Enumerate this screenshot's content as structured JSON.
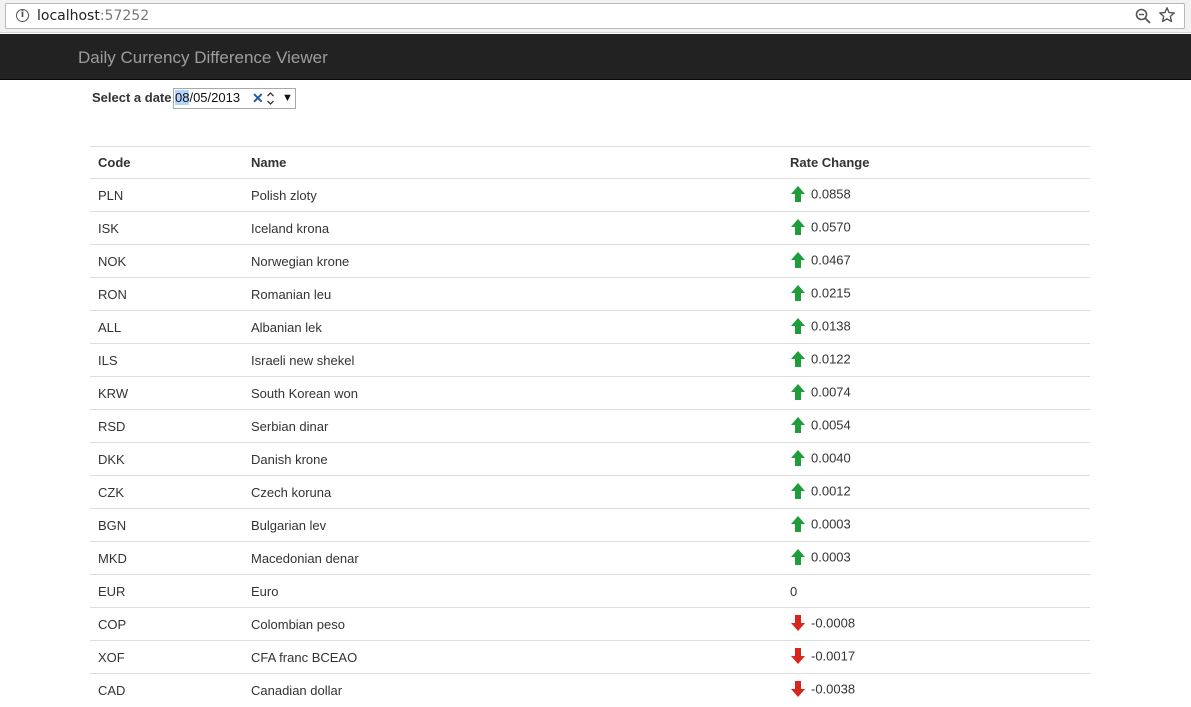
{
  "browser": {
    "url_host": "localhost",
    "url_port": ":57252"
  },
  "navbar": {
    "brand": "Daily Currency Difference Viewer"
  },
  "date_picker": {
    "label": "Select a date",
    "value_highlight": "08",
    "value_rest": "/05/2013"
  },
  "table": {
    "headers": {
      "code": "Code",
      "name": "Name",
      "rate_change": "Rate Change"
    },
    "rows": [
      {
        "code": "PLN",
        "name": "Polish zloty",
        "change": "0.0858",
        "trend": "up"
      },
      {
        "code": "ISK",
        "name": "Iceland krona",
        "change": "0.0570",
        "trend": "up"
      },
      {
        "code": "NOK",
        "name": "Norwegian krone",
        "change": "0.0467",
        "trend": "up"
      },
      {
        "code": "RON",
        "name": "Romanian leu",
        "change": "0.0215",
        "trend": "up"
      },
      {
        "code": "ALL",
        "name": "Albanian lek",
        "change": "0.0138",
        "trend": "up"
      },
      {
        "code": "ILS",
        "name": "Israeli new shekel",
        "change": "0.0122",
        "trend": "up"
      },
      {
        "code": "KRW",
        "name": "South Korean won",
        "change": "0.0074",
        "trend": "up"
      },
      {
        "code": "RSD",
        "name": "Serbian dinar",
        "change": "0.0054",
        "trend": "up"
      },
      {
        "code": "DKK",
        "name": "Danish krone",
        "change": "0.0040",
        "trend": "up"
      },
      {
        "code": "CZK",
        "name": "Czech koruna",
        "change": "0.0012",
        "trend": "up"
      },
      {
        "code": "BGN",
        "name": "Bulgarian lev",
        "change": "0.0003",
        "trend": "up"
      },
      {
        "code": "MKD",
        "name": "Macedonian denar",
        "change": "0.0003",
        "trend": "up"
      },
      {
        "code": "EUR",
        "name": "Euro",
        "change": "0",
        "trend": "none"
      },
      {
        "code": "COP",
        "name": "Colombian peso",
        "change": "-0.0008",
        "trend": "down"
      },
      {
        "code": "XOF",
        "name": "CFA franc BCEAO",
        "change": "-0.0017",
        "trend": "down"
      },
      {
        "code": "CAD",
        "name": "Canadian dollar",
        "change": "-0.0038",
        "trend": "down"
      }
    ]
  },
  "colors": {
    "up_arrow": "#1f9d3a",
    "down_arrow": "#d9261c",
    "navbar_bg": "#222222",
    "navbar_text": "#9d9d9d"
  },
  "icons": {
    "up": "arrow-up-icon",
    "down": "arrow-down-icon"
  }
}
